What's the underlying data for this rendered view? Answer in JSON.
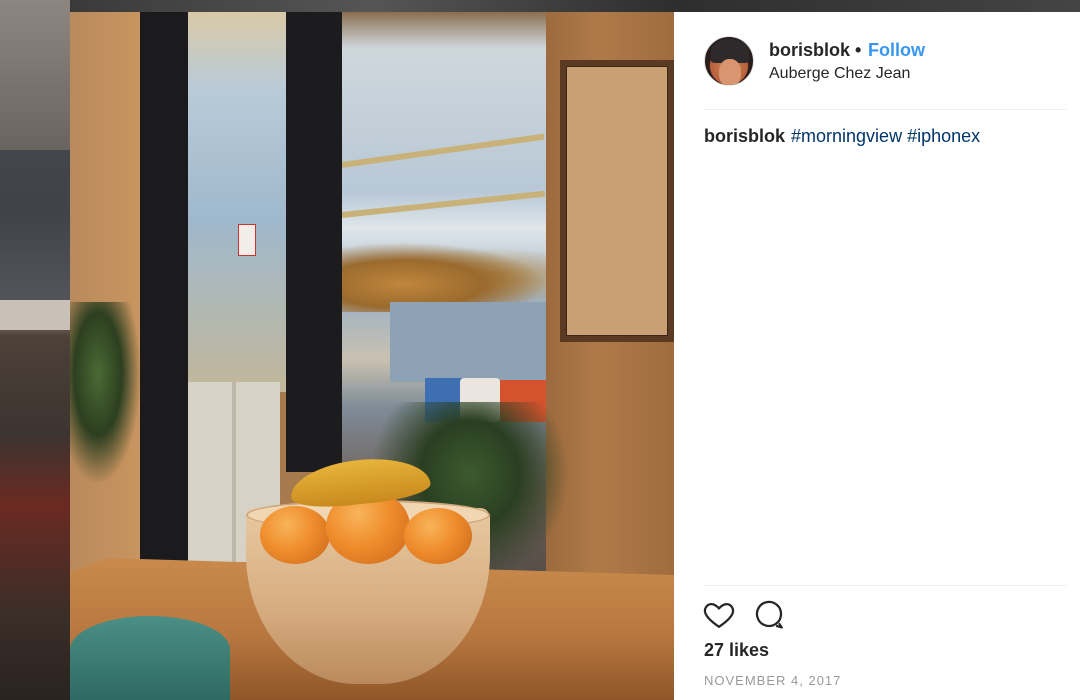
{
  "post": {
    "username": "borisblok",
    "separator": "•",
    "follow_label": "Follow",
    "location": "Auberge Chez Jean",
    "caption_user": "borisblok",
    "hashtags": [
      "#morningview",
      "#iphonex"
    ],
    "likes": "27 likes",
    "date": "NOVEMBER 4, 2017"
  },
  "icons": {
    "like": "heart-icon",
    "comment": "comment-bubble-icon"
  },
  "colors": {
    "follow": "#3897f0",
    "hashtag": "#003569",
    "date": "#999999"
  }
}
